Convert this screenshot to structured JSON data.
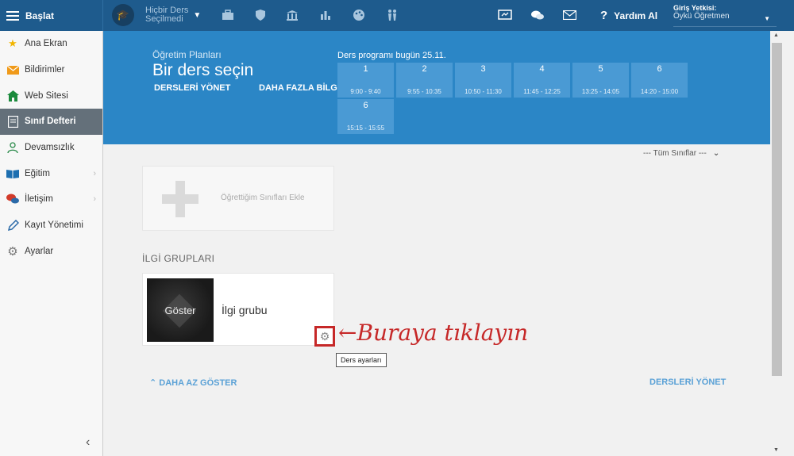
{
  "topbar": {
    "brand_label": "Başlat",
    "course_line1": "Hiçbir Ders",
    "course_line2": "Seçilmedi",
    "help_label": "Yardım Al",
    "auth_title": "Giriş Yetkisi:",
    "auth_value": "Öykü Öğretmen"
  },
  "sidebar": {
    "items": [
      {
        "label": "Ana Ekran",
        "icon": "star-icon"
      },
      {
        "label": "Bildirimler",
        "icon": "mail-icon"
      },
      {
        "label": "Web Sitesi",
        "icon": "home-icon"
      },
      {
        "label": "Sınıf Defteri",
        "icon": "notebook-icon"
      },
      {
        "label": "Devamsızlık",
        "icon": "person-icon"
      },
      {
        "label": "Eğitim",
        "icon": "book-icon"
      },
      {
        "label": "İletişim",
        "icon": "chat-icon"
      },
      {
        "label": "Kayıt Yönetimi",
        "icon": "pencil-icon"
      },
      {
        "label": "Ayarlar",
        "icon": "gear-icon"
      }
    ]
  },
  "banner": {
    "subtitle": "Öğretim Planları",
    "title": "Bir ders seçin",
    "manage_link": "DERSLERİ YÖNET",
    "more_link": "DAHA FAZLA BİLGİ",
    "schedule_title": "Ders programı bugün 25.11.",
    "slots": [
      {
        "n": "1",
        "time": "9:00 - 9:40"
      },
      {
        "n": "2",
        "time": "9:55 - 10:35"
      },
      {
        "n": "3",
        "time": "10:50 - 11:30"
      },
      {
        "n": "4",
        "time": "11:45 - 12:25"
      },
      {
        "n": "5",
        "time": "13:25 - 14:05"
      },
      {
        "n": "6",
        "time": "14:20 - 15:00"
      },
      {
        "n": "6",
        "time": "15:15 - 15:55"
      }
    ]
  },
  "main": {
    "filter_label": "--- Tüm Sınıflar ---",
    "add_card_label": "Öğrettiğim Sınıfları Ekle",
    "section_title": "İLGİ GRUPLARI",
    "group_thumb_label": "Göster",
    "group_name": "İlgi grubu",
    "annotation": "←Buraya tıklayın",
    "tooltip": "Ders ayarları",
    "show_less": "DAHA AZ GÖSTER",
    "manage_courses": "DERSLERİ YÖNET"
  },
  "colors": {
    "topbar": "#1e5b8d",
    "banner": "#2b86c6",
    "accent_red": "#c62828",
    "link_blue": "#5aa1d6"
  }
}
